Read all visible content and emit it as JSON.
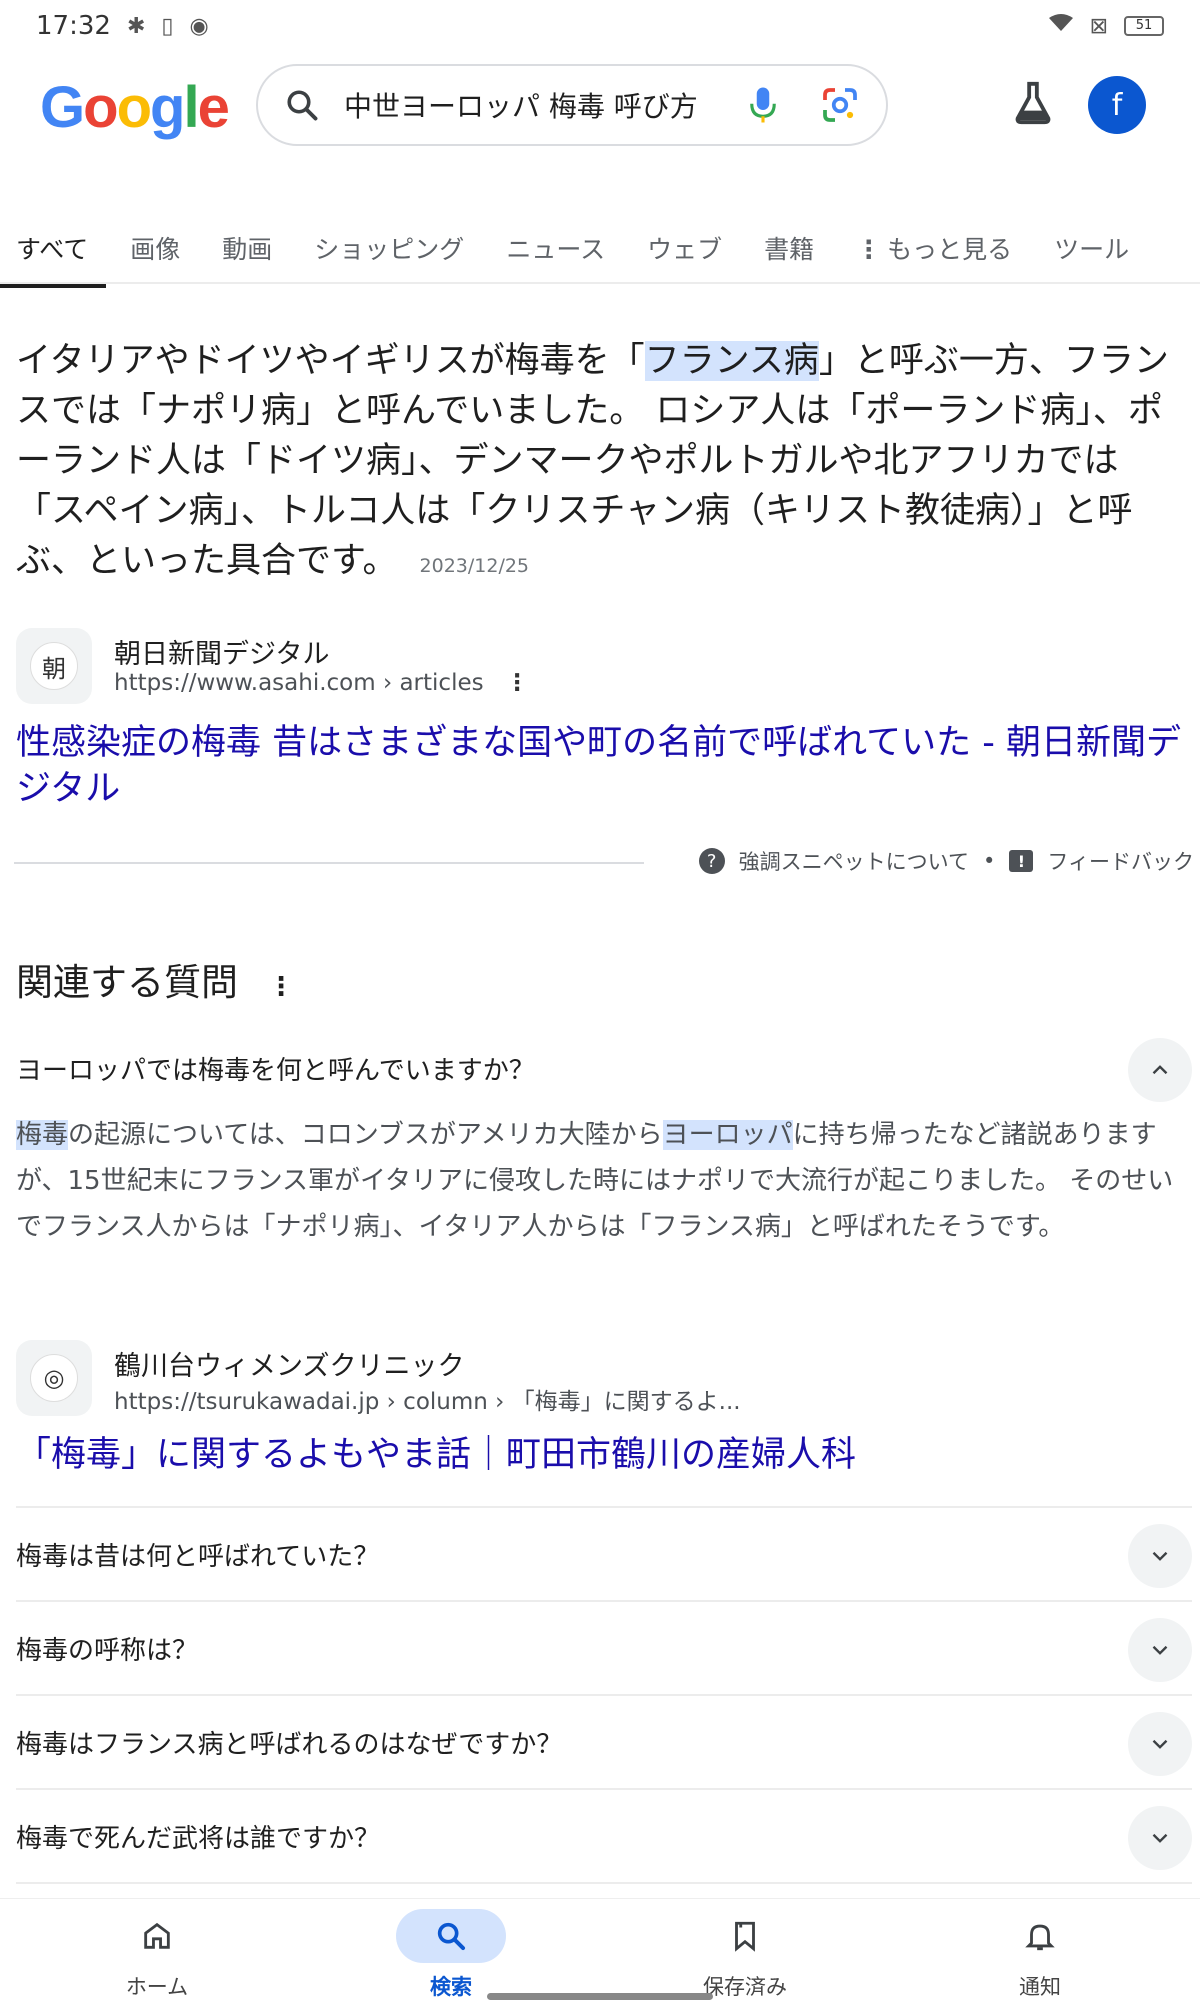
{
  "status_bar": {
    "time": "17:32",
    "battery": "51",
    "icons": [
      "bluetooth-icon",
      "vibrate-icon",
      "chrome-icon",
      "wifi-icon",
      "no-sim-icon",
      "battery-icon"
    ]
  },
  "header": {
    "logo_letters": [
      "G",
      "o",
      "o",
      "g",
      "l",
      "e"
    ],
    "search_query": "中世ヨーロッパ 梅毒 呼び方",
    "avatar_letter": "f"
  },
  "tabs": [
    {
      "label": "すべて",
      "active": true
    },
    {
      "label": "画像"
    },
    {
      "label": "動画"
    },
    {
      "label": "ショッピング"
    },
    {
      "label": "ニュース"
    },
    {
      "label": "ウェブ"
    },
    {
      "label": "書籍"
    },
    {
      "label": "もっと見る"
    },
    {
      "label": "ツール"
    }
  ],
  "snippet": {
    "text_before": "イタリアやドイツやイギリスが梅毒を「",
    "highlight": "フランス病",
    "text_after": "」と呼ぶ一方、フランスでは「ナポリ病」と呼んでいました。 ロシア人は「ポーランド病」、ポーランド人は「ドイツ病」、デンマークやポルトガルや北アフリカでは「スペイン病」、トルコ人は「クリスチャン病（キリスト教徒病）」と呼ぶ、といった具合です。",
    "date": "2023/12/25"
  },
  "source1": {
    "favicon_char": "朝",
    "name": "朝日新聞デジタル",
    "url": "https://www.asahi.com › articles",
    "title": "性感染症の梅毒 昔はさまざまな国や町の名前で呼ばれていた - 朝日新聞デジタル"
  },
  "feedback": {
    "about": "強調スニペットについて",
    "dot": "•",
    "feedback": "フィードバック"
  },
  "paa": {
    "title": "関連する質問",
    "open_question": "ヨーロッパでは梅毒を何と呼んでいますか？",
    "answer": {
      "hl1": "梅毒",
      "part1": "の起源については、コロンブスがアメリカ大陸から",
      "hl2": "ヨーロッパ",
      "part2": "に持ち帰ったなど諸説ありますが、15世紀末にフランス軍がイタリアに侵攻した時にはナポリで大流行が起こりました。 そのせいでフランス人からは「ナポリ病」、イタリア人からは「フランス病」と呼ばれたそうです。"
    },
    "source": {
      "favicon_char": "◎",
      "name": "鶴川台ウィメンズクリニック",
      "url": "https://tsurukawadai.jp › column › 「梅毒」に関するよ...",
      "title": "「梅毒」に関するよもやま話｜町田市鶴川の産婦人科"
    },
    "questions": [
      "梅毒は昔は何と呼ばれていた？",
      "梅毒の呼称は？",
      "梅毒はフランス病と呼ばれるのはなぜですか？",
      "梅毒で死んだ武将は誰ですか？"
    ]
  },
  "bottom_nav": [
    {
      "label": "ホーム",
      "icon": "home-icon"
    },
    {
      "label": "検索",
      "icon": "search-icon",
      "active": true
    },
    {
      "label": "保存済み",
      "icon": "bookmarks-icon"
    },
    {
      "label": "通知",
      "icon": "bell-icon"
    }
  ]
}
